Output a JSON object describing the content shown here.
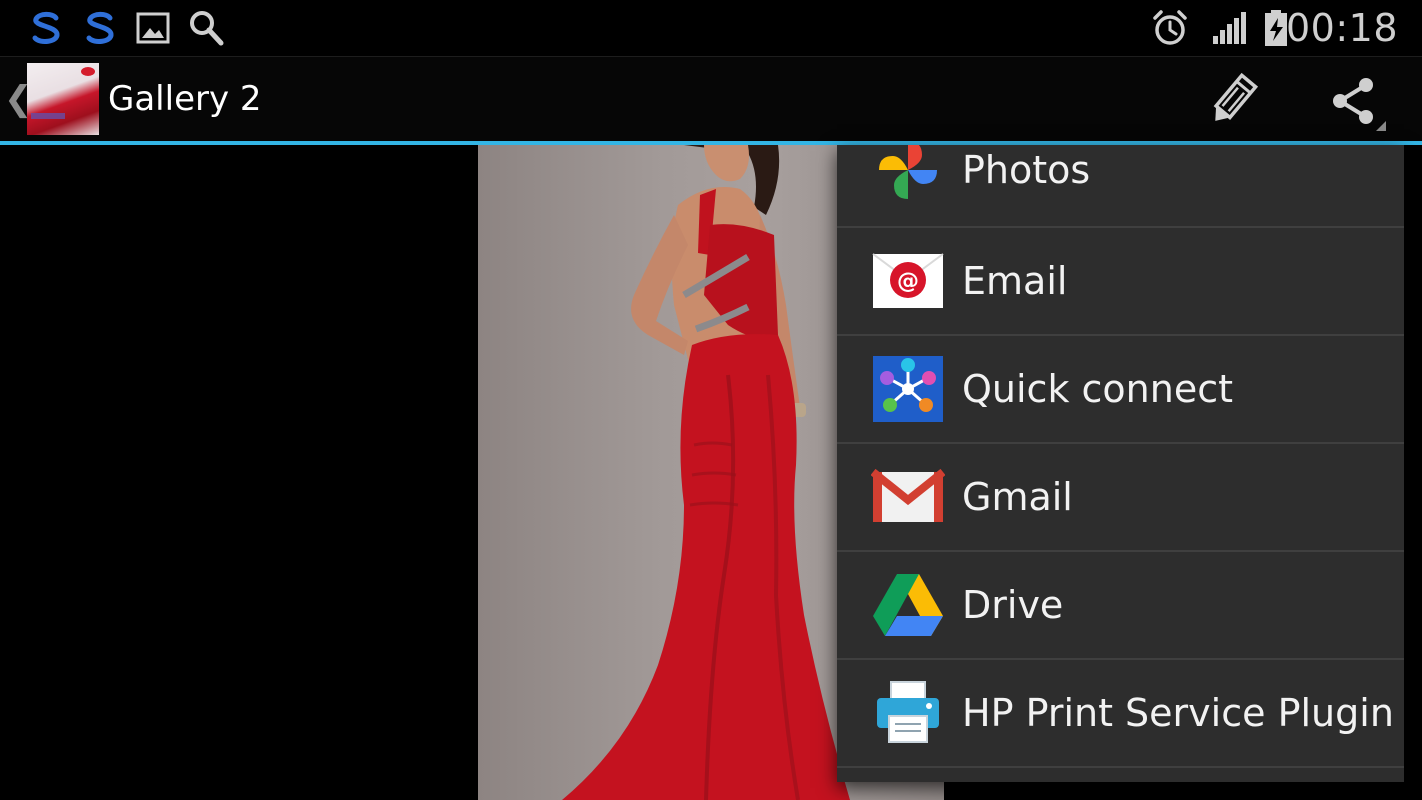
{
  "status_bar": {
    "time": "00:18",
    "icons": [
      "s-notification-icon",
      "s-notification-icon",
      "image-notification-icon",
      "search-notification-icon",
      "alarm-icon",
      "signal-icon",
      "battery-icon"
    ]
  },
  "action_bar": {
    "title": "Gallery 2",
    "up_icon": "chevron-left-icon",
    "actions": [
      "edit-icon",
      "share-icon"
    ]
  },
  "share_menu": {
    "items": [
      {
        "label": "Photos",
        "icon": "google-photos-icon"
      },
      {
        "label": "Email",
        "icon": "email-icon"
      },
      {
        "label": "Quick connect",
        "icon": "quick-connect-icon"
      },
      {
        "label": "Gmail",
        "icon": "gmail-icon"
      },
      {
        "label": "Drive",
        "icon": "google-drive-icon"
      },
      {
        "label": "HP Print Service Plugin",
        "icon": "printer-icon"
      }
    ]
  },
  "colors": {
    "accent": "#33b5e5",
    "menu_background": "#2d2d2d",
    "dress_red": "#c4121f"
  }
}
